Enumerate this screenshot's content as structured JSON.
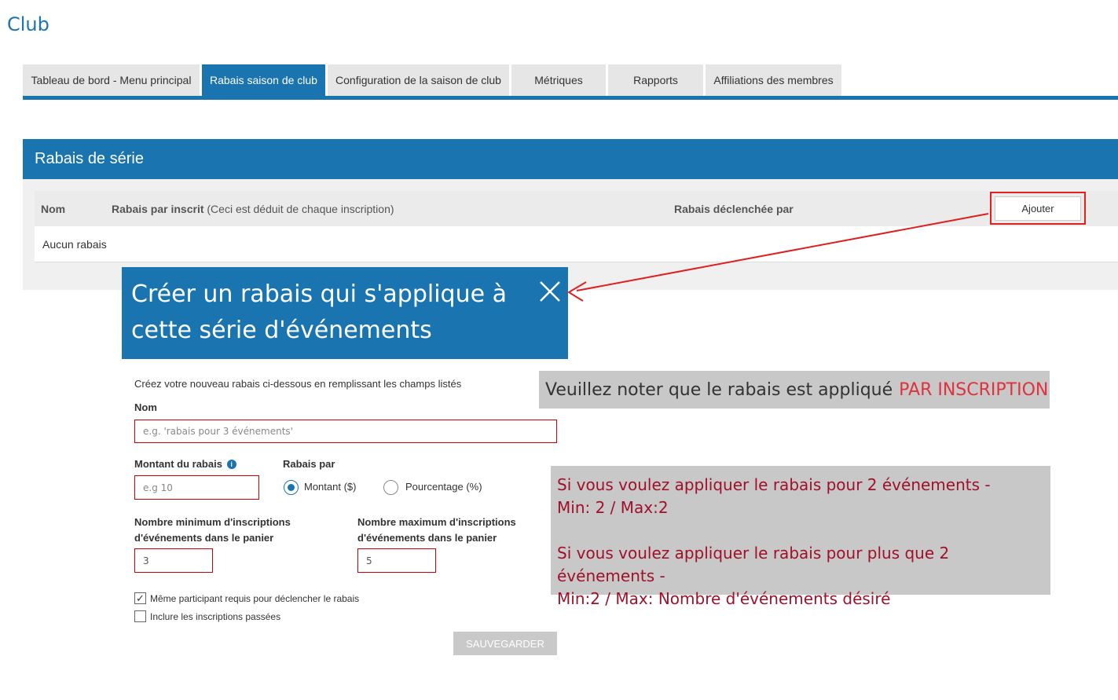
{
  "page": {
    "title": "Club"
  },
  "tabs": [
    {
      "label": "Tableau de bord - Menu principal",
      "active": false
    },
    {
      "label": "Rabais saison de club",
      "active": true
    },
    {
      "label": "Configuration de la saison de club",
      "active": false
    },
    {
      "label": "Métriques",
      "active": false
    },
    {
      "label": "Rapports",
      "active": false
    },
    {
      "label": "Affiliations des membres",
      "active": false
    }
  ],
  "panel": {
    "title": "Rabais de série",
    "columns": {
      "name": "Nom",
      "discount": "Rabais par inscrit",
      "discount_note": "(Ceci est déduit de chaque inscription)",
      "trigger": "Rabais déclenchée par"
    },
    "add_label": "Ajouter",
    "empty_text": "Aucun rabais"
  },
  "callout": {
    "text": "Créer un rabais qui s'applique à cette série d'événements",
    "close_icon": "close-icon"
  },
  "form": {
    "intro": "Créez votre nouveau rabais ci-dessous en remplissant les champs listés",
    "name_label": "Nom",
    "name_placeholder": "e.g. 'rabais pour 3 événements'",
    "amount_label": "Montant du rabais",
    "amount_placeholder": "e.g 10",
    "discount_by_label": "Rabais par",
    "option_amount": "Montant ($)",
    "option_percent": "Pourcentage (%)",
    "selected_option": "Montant ($)",
    "min_label_1": "Nombre minimum d'inscriptions",
    "min_label_2": "d'événements dans le panier",
    "min_value": "3",
    "max_label_1": "Nombre maximum d'inscriptions",
    "max_label_2": "d'événements dans le panier",
    "max_value": "5",
    "same_participant_label": "Même participant requis pour déclencher le rabais",
    "same_participant_checked": true,
    "include_past_label": "Inclure les inscriptions passées",
    "include_past_checked": false,
    "save_label": "SAUVEGARDER"
  },
  "notes": {
    "note1_text": "Veuillez noter que le rabais est appliqué",
    "note1_highlight": "PAR INSCRIPTION",
    "note2_line1": "Si vous voulez appliquer le rabais pour 2 événements -",
    "note2_line2": "Min: 2 / Max:2",
    "note2_line3": "Si vous voulez appliquer le rabais pour plus que 2 événements -",
    "note2_line4": "Min:2 / Max: Nombre d'événements désiré"
  },
  "colors": {
    "brand_blue": "#1a74b0",
    "annotation_red": "#e02020",
    "note_text_red": "#a0102a",
    "note_bg": "#c8c8c8"
  }
}
